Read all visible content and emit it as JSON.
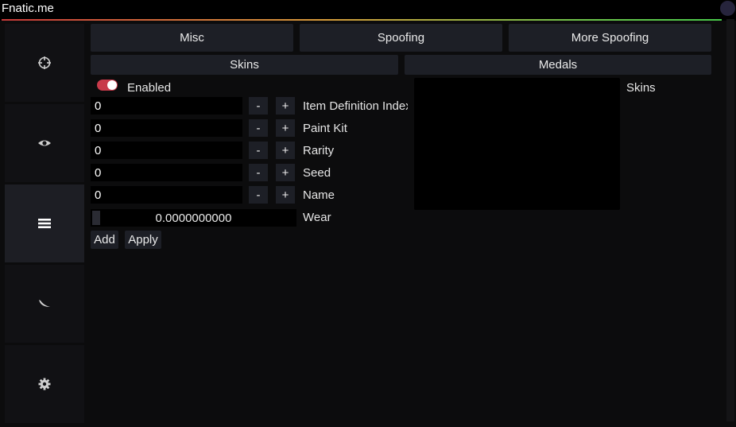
{
  "window": {
    "title": "Fnatic.me"
  },
  "sidebar": {
    "tabs": [
      {
        "icon": "crosshair-icon"
      },
      {
        "icon": "eye-icon"
      },
      {
        "icon": "menu-icon",
        "active": true
      },
      {
        "icon": "knife-icon"
      },
      {
        "icon": "gear-icon"
      }
    ]
  },
  "top_tabs": {
    "misc": "Misc",
    "spoofing": "Spoofing",
    "more_spoofing": "More Spoofing"
  },
  "sub_tabs": {
    "skins": "Skins",
    "medals": "Medals"
  },
  "skins": {
    "enabled_label": "Enabled",
    "enabled": true,
    "fields": [
      {
        "value": "0",
        "label": "Item Definition Index"
      },
      {
        "value": "0",
        "label": "Paint Kit"
      },
      {
        "value": "0",
        "label": "Rarity"
      },
      {
        "value": "0",
        "label": "Seed"
      },
      {
        "value": "0",
        "label": "Name"
      }
    ],
    "minus": "-",
    "plus": "+",
    "wear_value": "0.0000000000",
    "wear_label": "Wear",
    "add_label": "Add",
    "apply_label": "Apply",
    "list_label": "Skins"
  },
  "colors": {
    "accent": "#c83a4a",
    "button": "#1d1f26",
    "background": "#0c0c0d"
  }
}
